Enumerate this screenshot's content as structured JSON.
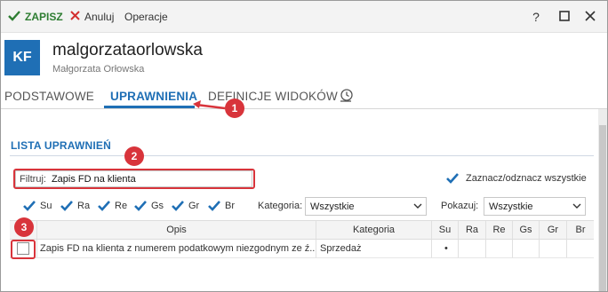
{
  "toolbar": {
    "save_label": "ZAPISZ",
    "cancel_label": "Anuluj",
    "operations_label": "Operacje",
    "help_glyph": "?",
    "icons": {
      "save": "check-icon",
      "cancel": "x-icon",
      "maximize": "maximize-icon",
      "close": "close-icon"
    },
    "colors": {
      "save": "#2e7d32",
      "cancel": "#d32f2f"
    }
  },
  "header": {
    "avatar_initials": "KF",
    "login": "malgorzataorlowska",
    "full_name": "Małgorzata Orłowska",
    "avatar_color": "#1f6fb5"
  },
  "tabs": [
    {
      "label": "PODSTAWOWE",
      "active": false
    },
    {
      "label": "UPRAWNIENIA",
      "active": true
    },
    {
      "label": "DEFINICJE WIDOKÓW",
      "active": false
    }
  ],
  "tabs_extra_icon": "history-clock-icon",
  "section": {
    "title": "LISTA UPRAWNIEŃ"
  },
  "filter": {
    "label": "Filtruj:",
    "value": "Zapis FD na klienta"
  },
  "select_all": {
    "label": "Zaznacz/odznacz wszystkie",
    "checked": true
  },
  "permission_checks": [
    {
      "label": "Su",
      "checked": true
    },
    {
      "label": "Ra",
      "checked": true
    },
    {
      "label": "Re",
      "checked": true
    },
    {
      "label": "Gs",
      "checked": true
    },
    {
      "label": "Gr",
      "checked": true
    },
    {
      "label": "Br",
      "checked": true
    }
  ],
  "category_filter": {
    "label": "Kategoria:",
    "value": "Wszystkie"
  },
  "show_filter": {
    "label": "Pokazuj:",
    "value": "Wszystkie"
  },
  "grid": {
    "columns": [
      "Opis",
      "Kategoria",
      "Su",
      "Ra",
      "Re",
      "Gs",
      "Gr",
      "Br"
    ],
    "rows": [
      {
        "checked": false,
        "opis": "Zapis FD na klienta z numerem podatkowym niezgodnym ze ź...",
        "kategoria": "Sprzedaż",
        "su": "•",
        "ra": "",
        "re": "",
        "gs": "",
        "gr": "",
        "br": ""
      }
    ]
  },
  "annotations": {
    "badges": [
      "1",
      "2",
      "3"
    ],
    "highlight_color": "#d8343b"
  },
  "accent_color": "#1f6fb5"
}
